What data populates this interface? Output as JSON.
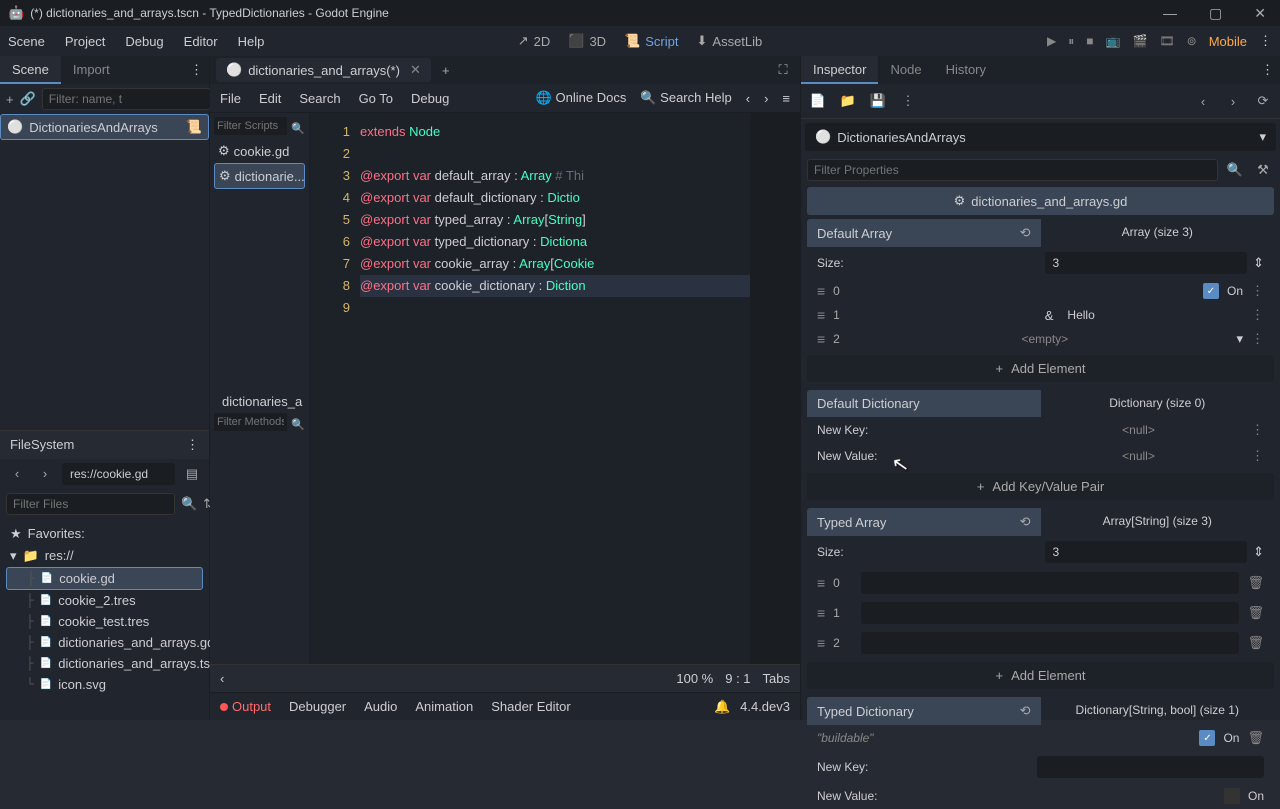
{
  "titlebar": {
    "title": "(*) dictionaries_and_arrays.tscn - TypedDictionaries - Godot Engine"
  },
  "menubar": {
    "items": [
      "Scene",
      "Project",
      "Debug",
      "Editor",
      "Help"
    ],
    "workspaces": [
      "2D",
      "3D",
      "Script",
      "AssetLib"
    ],
    "mobile_label": "Mobile"
  },
  "scene_panel": {
    "tabs": [
      "Scene",
      "Import"
    ],
    "filter_placeholder": "Filter: name, t",
    "root_node": "DictionariesAndArrays"
  },
  "filesystem": {
    "title": "FileSystem",
    "path": "res://cookie.gd",
    "filter_placeholder": "Filter Files",
    "favorites_label": "Favorites:",
    "root_label": "res://",
    "files": [
      {
        "name": "cookie.gd",
        "selected": true
      },
      {
        "name": "cookie_2.tres",
        "selected": false
      },
      {
        "name": "cookie_test.tres",
        "selected": false
      },
      {
        "name": "dictionaries_and_arrays.gd",
        "selected": false
      },
      {
        "name": "dictionaries_and_arrays.tscn",
        "selected": false
      },
      {
        "name": "icon.svg",
        "selected": false
      }
    ]
  },
  "script_editor": {
    "tab_name": "dictionaries_and_arrays(*)",
    "menus": [
      "File",
      "Edit",
      "Search",
      "Go To",
      "Debug"
    ],
    "online_docs": "Online Docs",
    "search_help": "Search Help",
    "filter_scripts_placeholder": "Filter Scripts",
    "scripts": [
      {
        "name": "cookie.gd",
        "active": false
      },
      {
        "name": "dictionarie...",
        "active": true
      }
    ],
    "outline_tab": "dictionaries_a",
    "filter_methods_placeholder": "Filter Methods",
    "lines": [
      {
        "n": 1,
        "tokens": [
          {
            "t": "extends ",
            "c": "kw-red"
          },
          {
            "t": "Node",
            "c": "kw-type"
          }
        ]
      },
      {
        "n": 2,
        "tokens": []
      },
      {
        "n": 3,
        "tokens": [
          {
            "t": "@export ",
            "c": "kw-red"
          },
          {
            "t": "var ",
            "c": "kw-var"
          },
          {
            "t": "default_array : ",
            "c": "code-text"
          },
          {
            "t": "Array ",
            "c": "kw-type"
          },
          {
            "t": "# Thi",
            "c": "kw-comment"
          }
        ]
      },
      {
        "n": 4,
        "tokens": [
          {
            "t": "@export ",
            "c": "kw-red"
          },
          {
            "t": "var ",
            "c": "kw-var"
          },
          {
            "t": "default_dictionary : ",
            "c": "code-text"
          },
          {
            "t": "Dictio",
            "c": "kw-type"
          }
        ]
      },
      {
        "n": 5,
        "tokens": [
          {
            "t": "@export ",
            "c": "kw-red"
          },
          {
            "t": "var ",
            "c": "kw-var"
          },
          {
            "t": "typed_array : ",
            "c": "code-text"
          },
          {
            "t": "Array",
            "c": "kw-type"
          },
          {
            "t": "[",
            "c": "code-text"
          },
          {
            "t": "String",
            "c": "kw-type"
          },
          {
            "t": "]",
            "c": "code-text"
          }
        ]
      },
      {
        "n": 6,
        "tokens": [
          {
            "t": "@export ",
            "c": "kw-red"
          },
          {
            "t": "var ",
            "c": "kw-var"
          },
          {
            "t": "typed_dictionary : ",
            "c": "code-text"
          },
          {
            "t": "Dictiona",
            "c": "kw-type"
          }
        ]
      },
      {
        "n": 7,
        "tokens": [
          {
            "t": "@export ",
            "c": "kw-red"
          },
          {
            "t": "var ",
            "c": "kw-var"
          },
          {
            "t": "cookie_array : ",
            "c": "code-text"
          },
          {
            "t": "Array",
            "c": "kw-type"
          },
          {
            "t": "[",
            "c": "code-text"
          },
          {
            "t": "Cookie",
            "c": "kw-type"
          }
        ]
      },
      {
        "n": 8,
        "tokens": [
          {
            "t": "@export ",
            "c": "kw-red"
          },
          {
            "t": "var ",
            "c": "kw-var"
          },
          {
            "t": "cookie_dictionary : ",
            "c": "code-text"
          },
          {
            "t": "Diction",
            "c": "kw-type"
          }
        ],
        "hl": true
      },
      {
        "n": 9,
        "tokens": []
      }
    ],
    "status": {
      "zoom": "100 %",
      "pos": "9  :   1",
      "tabs": "Tabs"
    }
  },
  "bottom_dock": {
    "items": [
      "Output",
      "Debugger",
      "Audio",
      "Animation",
      "Shader Editor"
    ],
    "version": "4.4.dev3"
  },
  "inspector": {
    "tabs": [
      "Inspector",
      "Node",
      "History"
    ],
    "node_name": "DictionariesAndArrays",
    "filter_placeholder": "Filter Properties",
    "script_name": "dictionaries_and_arrays.gd",
    "sections": {
      "default_array": {
        "title": "Default Array",
        "type_label": "Array (size 3)",
        "size_label": "Size:",
        "size_value": "3",
        "items": [
          {
            "idx": "0",
            "type": "check",
            "text": "On"
          },
          {
            "idx": "1",
            "type": "text",
            "prefix": "&",
            "text": "Hello"
          },
          {
            "idx": "2",
            "type": "empty",
            "text": "<empty>"
          }
        ],
        "add_label": "Add Element"
      },
      "default_dict": {
        "title": "Default Dictionary",
        "type_label": "Dictionary (size 0)",
        "new_key_label": "New Key:",
        "new_key_value": "<null>",
        "new_value_label": "New Value:",
        "new_value_value": "<null>",
        "add_label": "Add Key/Value Pair"
      },
      "typed_array": {
        "title": "Typed Array",
        "type_label": "Array[String] (size 3)",
        "size_label": "Size:",
        "size_value": "3",
        "items": [
          {
            "idx": "0"
          },
          {
            "idx": "1"
          },
          {
            "idx": "2"
          }
        ],
        "add_label": "Add Element"
      },
      "typed_dict": {
        "title": "Typed Dictionary",
        "type_label": "Dictionary[String, bool] (size 1)",
        "key0": "\"buildable\"",
        "val0": "On",
        "new_key_label": "New Key:",
        "new_value_label": "New Value:",
        "new_value_text": "On"
      }
    }
  }
}
